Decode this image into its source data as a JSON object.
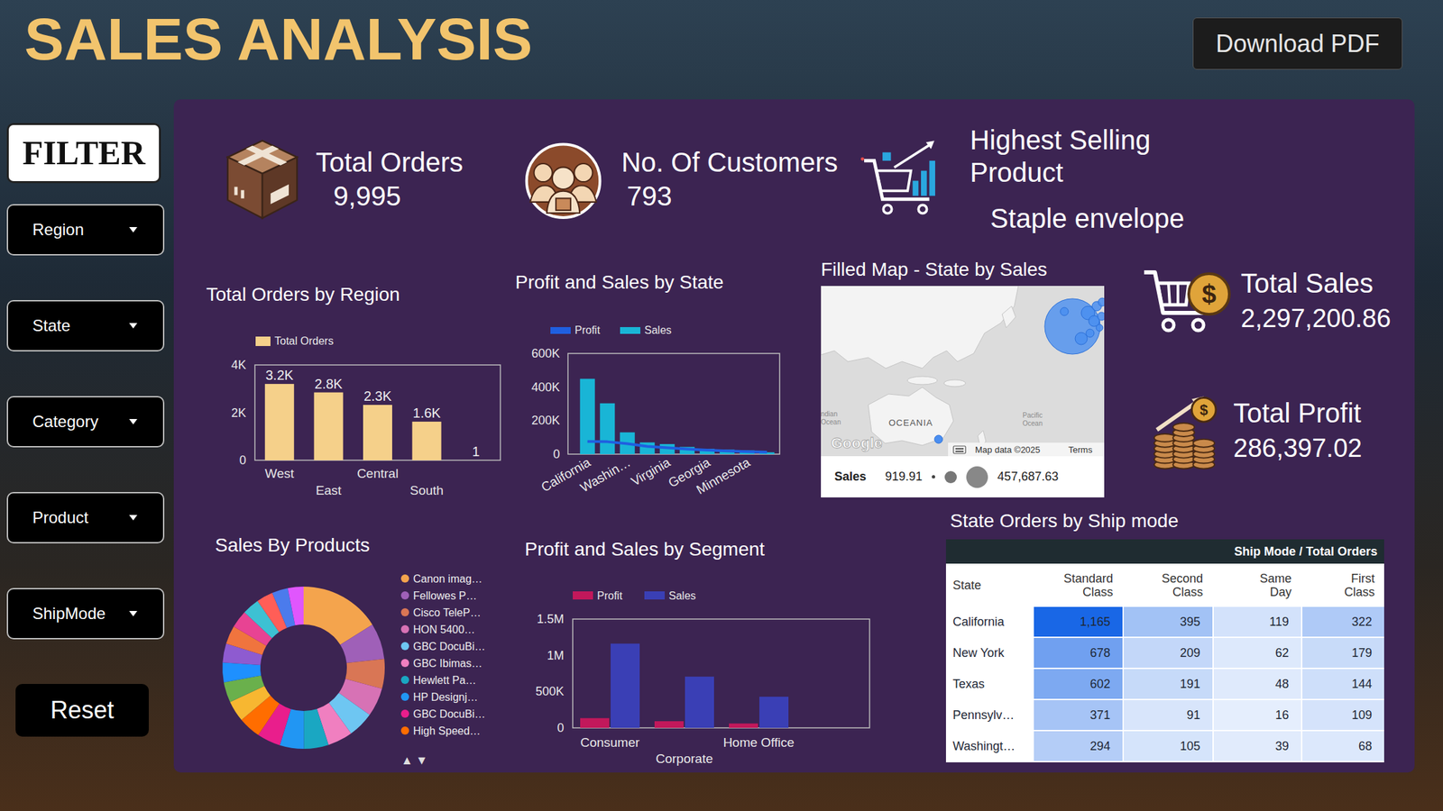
{
  "header": {
    "title": "SALES ANALYSIS",
    "download_button": "Download PDF"
  },
  "filters": {
    "title": "FILTER",
    "dropdowns": [
      "Region",
      "State",
      "Category",
      "Product",
      "ShipMode"
    ],
    "reset_button": "Reset"
  },
  "kpis": [
    {
      "label": "Total Orders",
      "value": "9,995"
    },
    {
      "label": "No. Of Customers",
      "value": "793"
    },
    {
      "label": "Highest Selling Product",
      "value": "Staple envelope"
    }
  ],
  "side_kpis": [
    {
      "label": "Total Sales",
      "value": "2,297,200.86",
      "icon_symbol": "$"
    },
    {
      "label": "Total Profit",
      "value": "286,397.02",
      "icon_symbol": "$"
    }
  ],
  "orders_by_region": {
    "title": "Total Orders by Region",
    "legend": "Total Orders",
    "ticks": [
      {
        "label": "4K",
        "value": 4000
      },
      {
        "label": "2K",
        "value": 2000
      },
      {
        "label": "0",
        "value": 0
      }
    ],
    "values": [
      3203,
      2848,
      2323,
      1620,
      1
    ],
    "value_labels": [
      "3.2K",
      "2.8K",
      "2.3K",
      "1.6K",
      "1"
    ],
    "categories": [
      "West",
      "East",
      "Central",
      "South"
    ]
  },
  "profit_sales_by_state": {
    "title": "Profit and Sales by State",
    "legend": [
      {
        "label": "Profit",
        "color": "#1f5fe0"
      },
      {
        "label": "Sales",
        "color": "#19b5d6"
      }
    ],
    "ticks": [
      {
        "label": "600K",
        "value": 600000
      },
      {
        "label": "400K",
        "value": 400000
      },
      {
        "label": "200K",
        "value": 200000
      },
      {
        "label": "0",
        "value": 0
      }
    ],
    "sales": [
      449000,
      303000,
      130000,
      70000,
      60000,
      43000,
      32000,
      27000,
      22000,
      11000
    ],
    "profit": [
      76000,
      74000,
      62000,
      46000,
      38000,
      30000,
      24000,
      19000,
      15000,
      12000
    ],
    "labels": [
      {
        "text": "California",
        "index": 0
      },
      {
        "text": "Washin…",
        "index": 2
      },
      {
        "text": "Virginia",
        "index": 4
      },
      {
        "text": "Georgia",
        "index": 6
      },
      {
        "text": "Minnesota",
        "index": 8
      }
    ]
  },
  "map": {
    "title": "Filled Map - State by Sales",
    "labels": [
      "OCEANIA",
      "ndian",
      "Ocean",
      "Pacific",
      "Ocean"
    ],
    "logo": "Google",
    "attribution": "Map data ©2025",
    "terms": "Terms",
    "legend": {
      "label": "Sales",
      "min": "919.91",
      "max": "457,687.63"
    }
  },
  "sales_by_products": {
    "title": "Sales By Products",
    "pager": "▲▼",
    "segments": [
      {
        "label": "Canon imag…",
        "value": 61600,
        "color": "#f4a44d"
      },
      {
        "label": "Fellowes P…",
        "value": 27453,
        "color": "#9f60b8"
      },
      {
        "label": "Cisco TeleP…",
        "value": 22638,
        "color": "#d97655"
      },
      {
        "label": "HON 5400…",
        "value": 21870,
        "color": "#d772b5"
      },
      {
        "label": "GBC DocuBi…",
        "value": 19823,
        "color": "#6ec6f2"
      },
      {
        "label": "GBC Ibimas…",
        "value": 19024,
        "color": "#f07fc0"
      },
      {
        "label": "Hewlett Pa…",
        "value": 18840,
        "color": "#1aa7c2"
      },
      {
        "label": "HP Designj…",
        "value": 18375,
        "color": "#2196f3"
      },
      {
        "label": "GBC DocuBi…",
        "value": 17965,
        "color": "#e91e8c"
      },
      {
        "label": "High Speed…",
        "value": 17030,
        "color": "#ff6d00"
      },
      {
        "value": 16000,
        "color": "#f7b731"
      },
      {
        "value": 15500,
        "color": "#6ab04c"
      },
      {
        "value": 15000,
        "color": "#1e90ff"
      },
      {
        "value": 14500,
        "color": "#8e5bd0"
      },
      {
        "value": 14000,
        "color": "#f0743e"
      },
      {
        "value": 13500,
        "color": "#e84393"
      },
      {
        "value": 13000,
        "color": "#3dc1d3"
      },
      {
        "value": 12600,
        "color": "#ff5e57"
      },
      {
        "value": 12200,
        "color": "#4b7bec"
      },
      {
        "value": 12000,
        "color": "#e056fd"
      }
    ]
  },
  "profit_sales_by_segment": {
    "title": "Profit and Sales by Segment",
    "legend": [
      {
        "label": "Profit",
        "color": "#c2185b"
      },
      {
        "label": "Sales",
        "color": "#3a3fb5"
      }
    ],
    "ticks": [
      {
        "label": "1.5M",
        "value": 1500000
      },
      {
        "label": "1M",
        "value": 1000000
      },
      {
        "label": "500K",
        "value": 500000
      },
      {
        "label": "0",
        "value": 0
      }
    ],
    "categories": [
      "Consumer",
      "Corporate",
      "Home Office"
    ],
    "profit": [
      134119,
      91979,
      60299
    ],
    "sales": [
      1161401,
      706146,
      429653
    ]
  },
  "ship_mode_table": {
    "title": "State Orders by Ship mode",
    "header": "Ship Mode / Total Orders",
    "columns": [
      "State",
      "Standard Class",
      "Second Class",
      "Same Day",
      "First Class"
    ],
    "rows": [
      {
        "state": "California",
        "values": [
          "1,165",
          "395",
          "119",
          "322"
        ]
      },
      {
        "state": "New York",
        "values": [
          "678",
          "209",
          "62",
          "179"
        ]
      },
      {
        "state": "Texas",
        "values": [
          "602",
          "191",
          "48",
          "144"
        ]
      },
      {
        "state": "Pennsylv…",
        "values": [
          "371",
          "91",
          "16",
          "109"
        ]
      },
      {
        "state": "Washingt…",
        "values": [
          "294",
          "105",
          "39",
          "68"
        ]
      }
    ]
  }
}
